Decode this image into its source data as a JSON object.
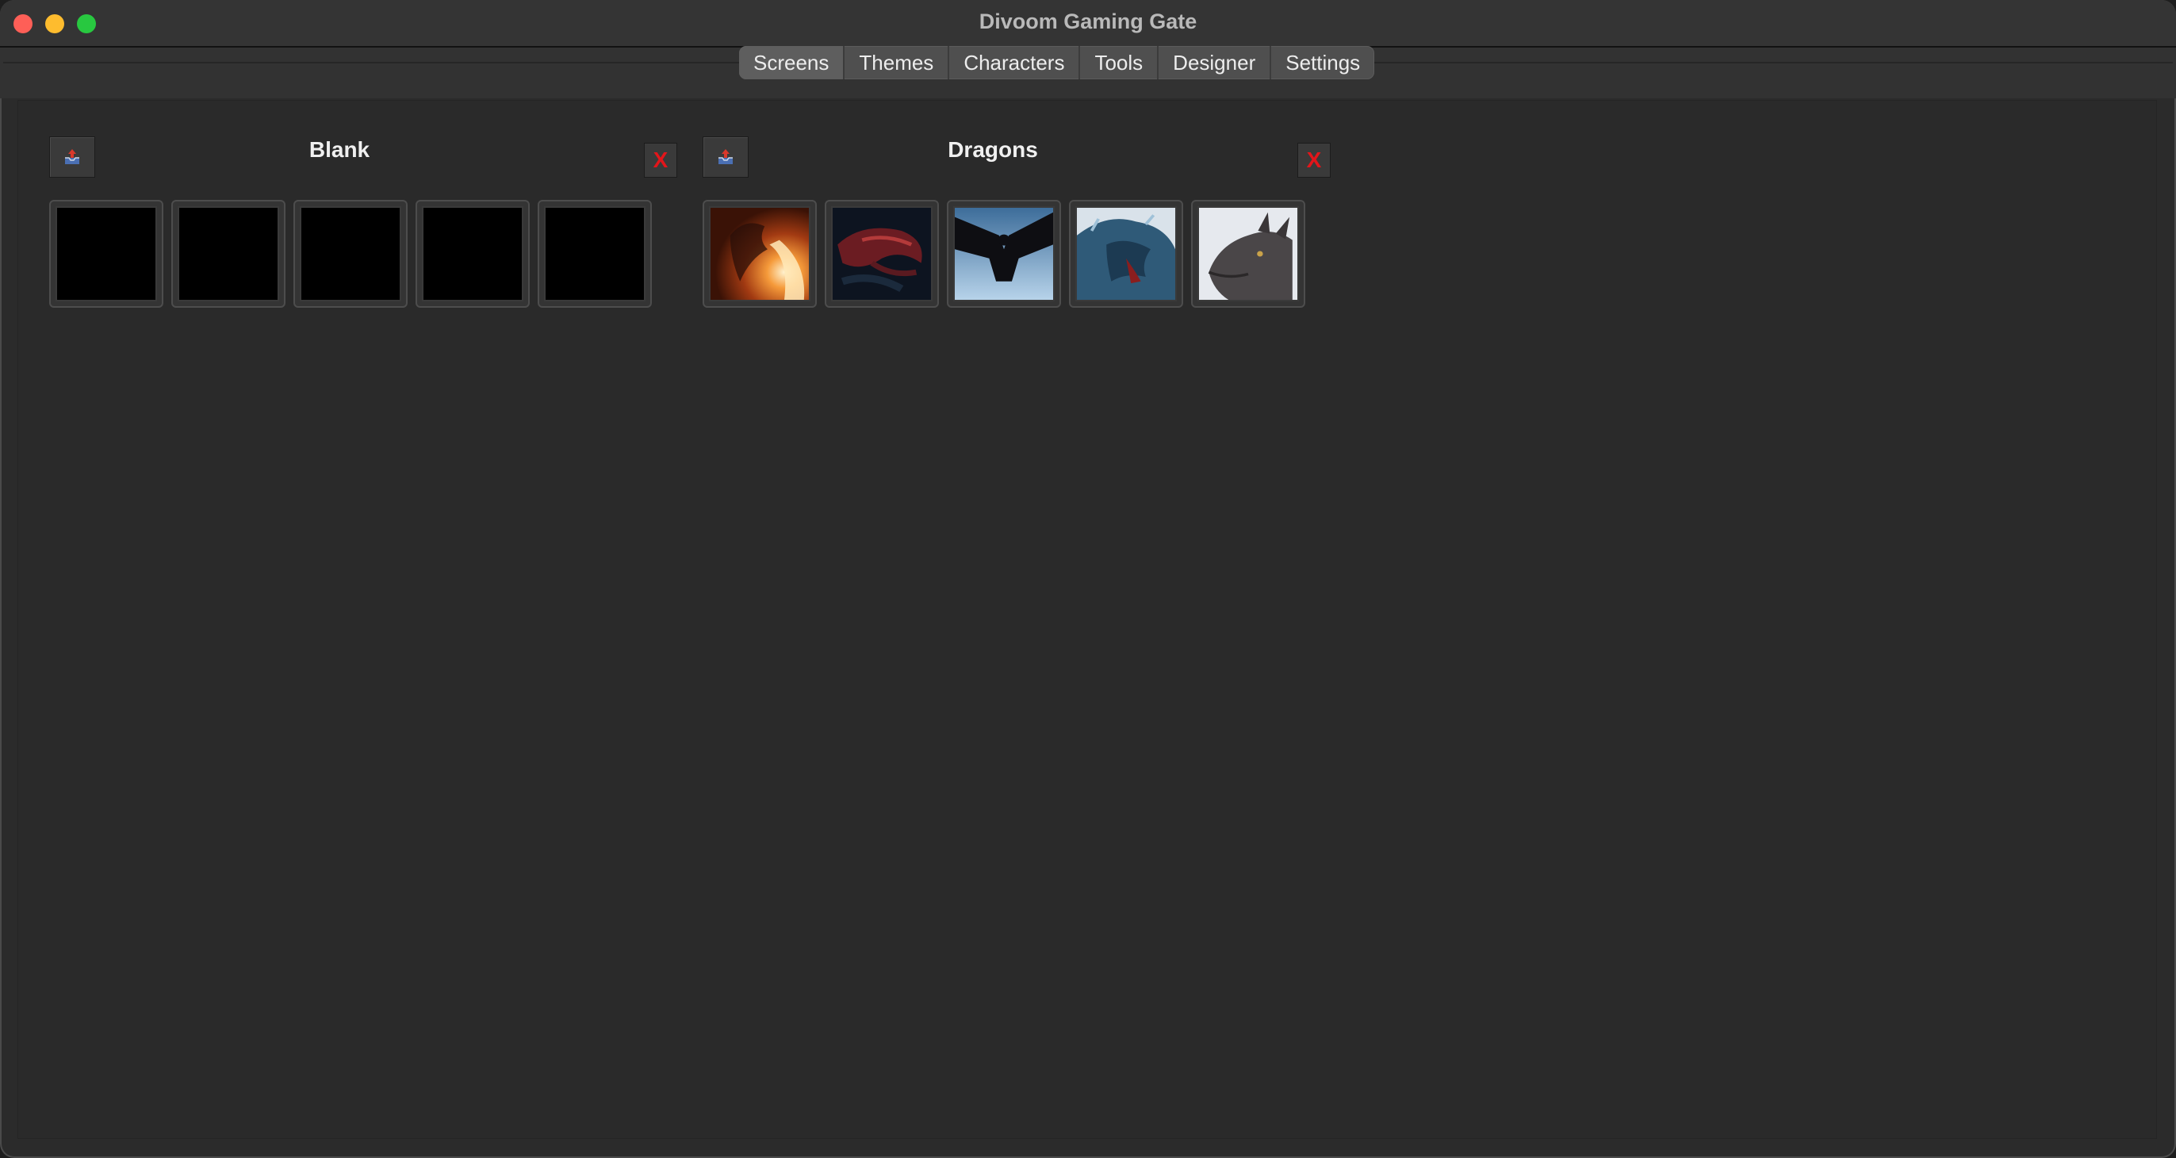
{
  "window": {
    "title": "Divoom Gaming Gate"
  },
  "tabs": [
    {
      "label": "Screens"
    },
    {
      "label": "Themes"
    },
    {
      "label": "Characters"
    },
    {
      "label": "Tools"
    },
    {
      "label": "Designer"
    },
    {
      "label": "Settings"
    }
  ],
  "groups": [
    {
      "title": "Blank",
      "close_label": "X",
      "tiles": [
        "blank",
        "blank",
        "blank",
        "blank",
        "blank"
      ]
    },
    {
      "title": "Dragons",
      "close_label": "X",
      "tiles": [
        "dragon-fire",
        "dragon-red-dark",
        "dragon-flying-sky",
        "dragon-blue-roar",
        "dragon-grey-head"
      ]
    }
  ],
  "icons": {
    "upload": "upload-tray-icon"
  },
  "colors": {
    "close_x": "#e3151a",
    "background": "#2a2a2a"
  }
}
